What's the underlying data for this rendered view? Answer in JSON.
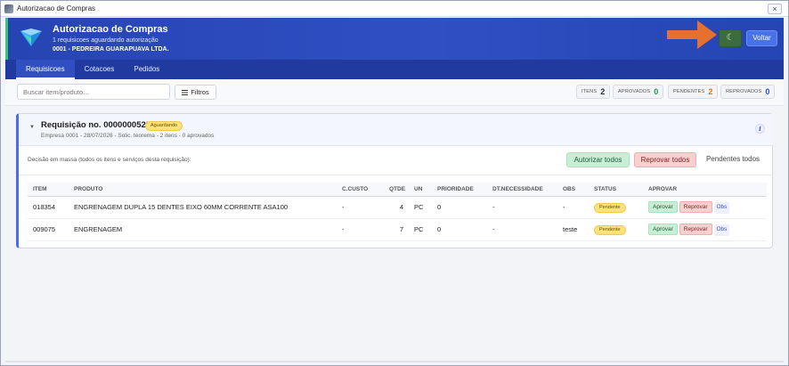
{
  "window": {
    "title": "Autorizacao de Compras",
    "close_glyph": "×"
  },
  "header": {
    "title": "Autorizacao de Compras",
    "subtitle": "1 requisicoes aguardando autorização",
    "company": "0001 - PEDREIRA GUARAPUAVA LTDA.",
    "theme_glyph": "☾",
    "back_label": "Voltar",
    "colors": {
      "accent": "#2f4fc3",
      "stripe": "#34c77a",
      "arrow": "#e8702e"
    }
  },
  "tabs": [
    {
      "label": "Requisicoes",
      "active": true
    },
    {
      "label": "Cotacoes",
      "active": false
    },
    {
      "label": "Pedidos",
      "active": false
    }
  ],
  "toolbar": {
    "search_placeholder": "Buscar item/produto...",
    "filter_label": "Filtros",
    "stats": [
      {
        "label": "ITENS",
        "value": "2",
        "color": "#1f2937"
      },
      {
        "label": "APROVADOS",
        "value": "0",
        "color": "#1e9b4f"
      },
      {
        "label": "PENDENTES",
        "value": "2",
        "color": "#d9730d"
      },
      {
        "label": "REPROVADOS",
        "value": "0",
        "color": "#2f4fc3"
      }
    ]
  },
  "requisition": {
    "title": "Requisição no. 0000000528",
    "status": "Aguardando",
    "subtitle": "Empresa 0001 - 28/07/2026 - Solic. teorema - 2 itens - 0 aprovados",
    "info_glyph": "i",
    "mass_label": "Decisão em massa (todos os itens e serviços desta requisição):",
    "authorize_all": "Autorizar todos",
    "reject_all": "Reprovar todos",
    "pending_all": "Pendentes todos",
    "columns": [
      "ITEM",
      "PRODUTO",
      "C.CUSTO",
      "QTDE",
      "UN",
      "PRIORIDADE",
      "DT.NECESSIDADE",
      "OBS",
      "STATUS",
      "APROVAR"
    ],
    "rows": [
      {
        "item": "018354",
        "produto": "ENGRENAGEM DUPLA 15 DENTES EIXO 60MM CORRENTE ASA100",
        "ccusto": "-",
        "qtde": "4",
        "un": "PC",
        "prioridade": "0",
        "dt": "-",
        "obs": "-",
        "status": "Pendente",
        "approve": "Aprovar",
        "reject": "Reprovar",
        "obs_btn": "Obs"
      },
      {
        "item": "009075",
        "produto": "ENGRENAGEM",
        "ccusto": "-",
        "qtde": "7",
        "un": "PC",
        "prioridade": "0",
        "dt": "-",
        "obs": "teste",
        "status": "Pendente",
        "approve": "Aprovar",
        "reject": "Reprovar",
        "obs_btn": "Obs"
      }
    ]
  }
}
